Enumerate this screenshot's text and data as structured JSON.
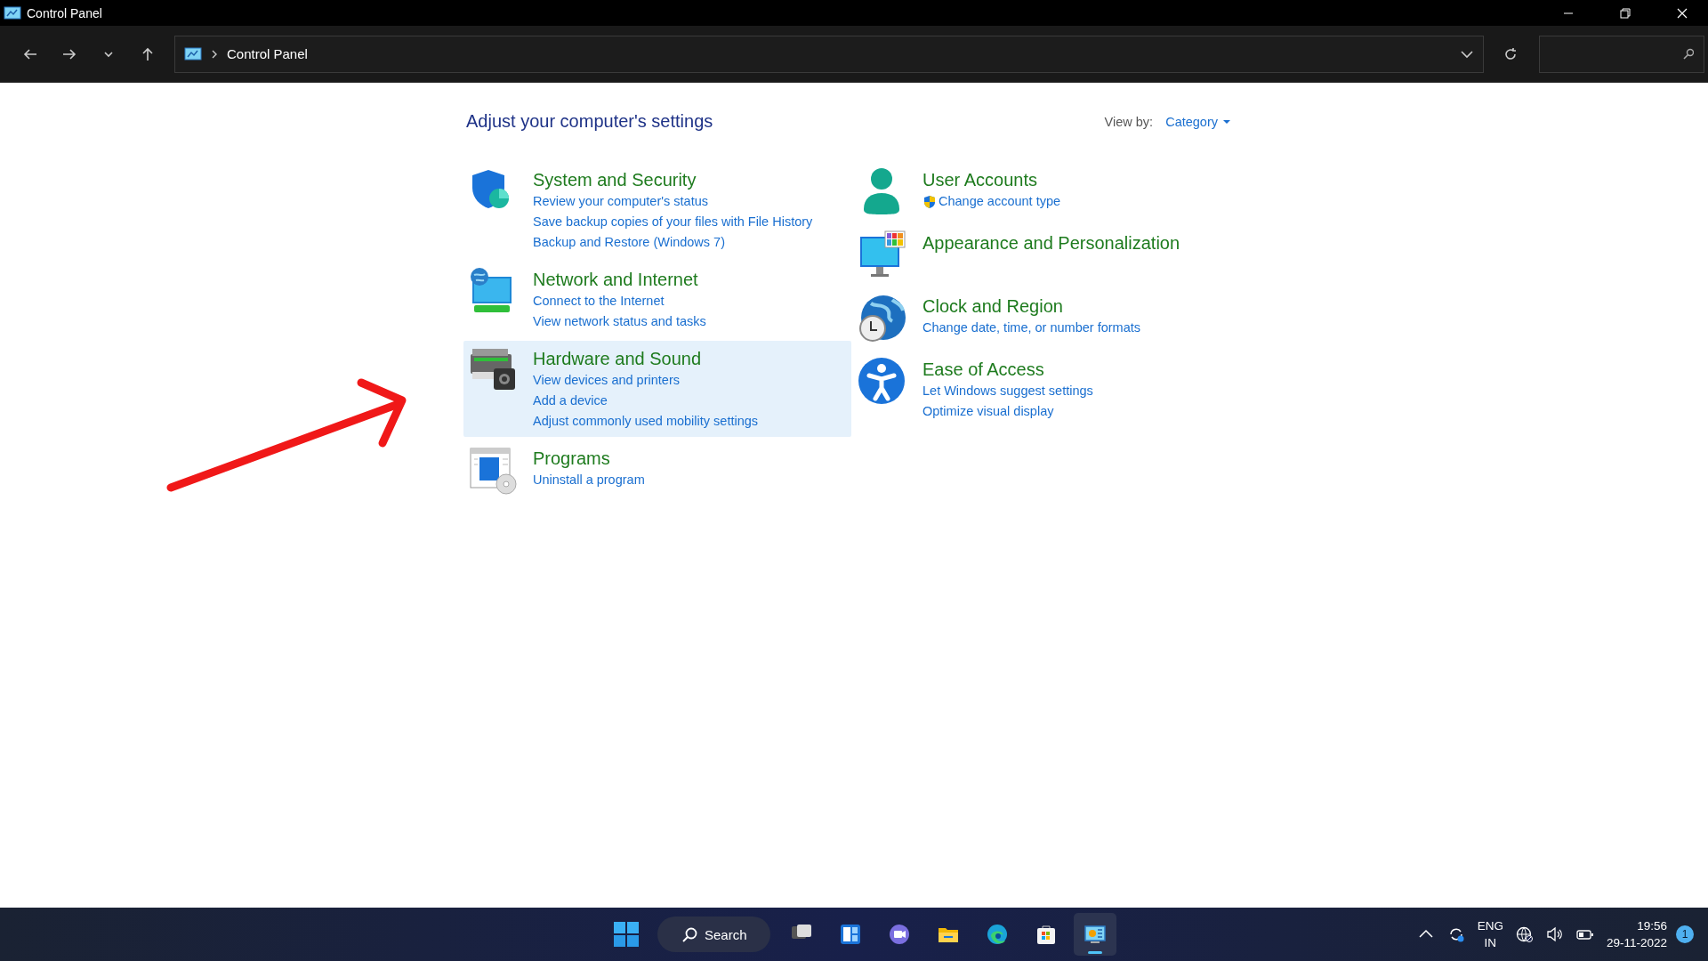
{
  "window": {
    "title": "Control Panel"
  },
  "address_bar": {
    "path": "Control Panel"
  },
  "content": {
    "heading": "Adjust your computer's settings",
    "view_by": {
      "label": "View by:",
      "value": "Category"
    },
    "columns": [
      [
        {
          "kind": "security",
          "title": "System and Security",
          "highlighted": false,
          "links": [
            {
              "text": "Review your computer's status",
              "shield": false
            },
            {
              "text": "Save backup copies of your files with File History",
              "shield": false
            },
            {
              "text": "Backup and Restore (Windows 7)",
              "shield": false
            }
          ]
        },
        {
          "kind": "network",
          "title": "Network and Internet",
          "highlighted": false,
          "links": [
            {
              "text": "Connect to the Internet",
              "shield": false
            },
            {
              "text": "View network status and tasks",
              "shield": false
            }
          ]
        },
        {
          "kind": "hardware",
          "title": "Hardware and Sound",
          "highlighted": true,
          "links": [
            {
              "text": "View devices and printers",
              "shield": false
            },
            {
              "text": "Add a device",
              "shield": false
            },
            {
              "text": "Adjust commonly used mobility settings",
              "shield": false
            }
          ]
        },
        {
          "kind": "programs",
          "title": "Programs",
          "highlighted": false,
          "links": [
            {
              "text": "Uninstall a program",
              "shield": false
            }
          ]
        }
      ],
      [
        {
          "kind": "user",
          "title": "User Accounts",
          "highlighted": false,
          "links": [
            {
              "text": "Change account type",
              "shield": true
            }
          ]
        },
        {
          "kind": "appearance",
          "title": "Appearance and Personalization",
          "highlighted": false
        },
        {
          "kind": "clock",
          "title": "Clock and Region",
          "highlighted": false,
          "links": [
            {
              "text": "Change date, time, or number formats",
              "shield": false
            }
          ]
        },
        {
          "kind": "access",
          "title": "Ease of Access",
          "highlighted": false,
          "links": [
            {
              "text": "Let Windows suggest settings",
              "shield": false
            },
            {
              "text": "Optimize visual display",
              "shield": false
            }
          ]
        }
      ]
    ]
  },
  "taskbar": {
    "search_label": "Search",
    "apps": [
      {
        "kind": "taskview",
        "active": false
      },
      {
        "kind": "widgets",
        "active": false
      },
      {
        "kind": "chat",
        "active": false
      },
      {
        "kind": "explorer",
        "active": false
      },
      {
        "kind": "edge",
        "active": false
      },
      {
        "kind": "store",
        "active": false
      },
      {
        "kind": "controlpanel",
        "active": true
      }
    ],
    "language": "ENG",
    "region": "IN",
    "time": "19:56",
    "date": "29-11-2022",
    "notifications": "1"
  }
}
